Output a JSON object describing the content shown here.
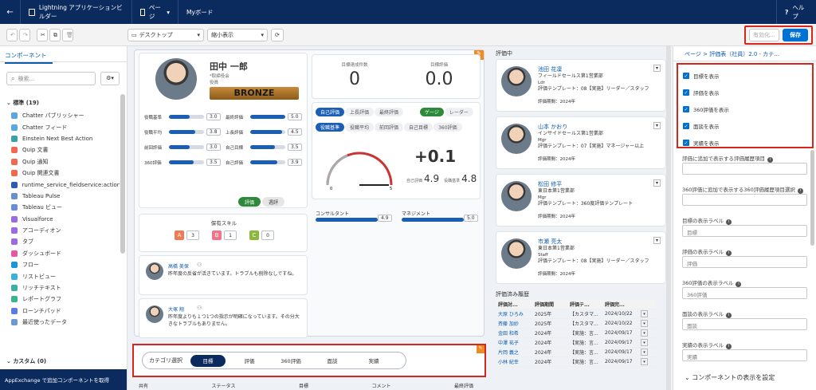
{
  "topbar": {
    "back_icon": "arrow-left-icon",
    "app_title": "Lightning アプリケーションビルダー",
    "page_menu": "ページ",
    "page_name": "Myボード",
    "help": "ヘルプ"
  },
  "toolbar": {
    "device": "デスクトップ",
    "view": "縮小表示",
    "save_secondary": "有効化...",
    "save": "保存"
  },
  "left": {
    "tab": "コンポーネント",
    "search_placeholder": "検索...",
    "standard_header": "標準 (19)",
    "items": [
      {
        "label": "Chatter パブリッシャー",
        "color": "#5aa7e0"
      },
      {
        "label": "Chatter フィード",
        "color": "#5aa7e0"
      },
      {
        "label": "Einstein Next Best Action",
        "color": "#3ba0a8"
      },
      {
        "label": "Quip 文書",
        "color": "#f26a4e"
      },
      {
        "label": "Quip 通知",
        "color": "#f26a4e"
      },
      {
        "label": "Quip 関連文書",
        "color": "#f26a4e"
      },
      {
        "label": "runtime_service_fieldservice:action...",
        "color": "#2f5ca8"
      },
      {
        "label": "Tableau Pulse",
        "color": "#6a8fd0"
      },
      {
        "label": "Tableau ビュー",
        "color": "#6a8fd0"
      },
      {
        "label": "Visualforce",
        "color": "#9d6be0"
      },
      {
        "label": "アコーディオン",
        "color": "#9d6be0"
      },
      {
        "label": "タブ",
        "color": "#9d6be0"
      },
      {
        "label": "ダッシュボード",
        "color": "#e25ba0"
      },
      {
        "label": "フロー",
        "color": "#1b96d2"
      },
      {
        "label": "リストビュー",
        "color": "#3bb0e0"
      },
      {
        "label": "リッチテキスト",
        "color": "#3bb0a0"
      },
      {
        "label": "レポートグラフ",
        "color": "#39b58a"
      },
      {
        "label": "ローンチパッド",
        "color": "#5b7be0"
      },
      {
        "label": "最近使ったデータ",
        "color": "#6d98d8"
      }
    ],
    "custom_header": "カスタム (0)",
    "appexchange": "AppExchange で追加コンポーネントを取得"
  },
  "profile": {
    "name": "田中 一郎",
    "sub1": "*取締役会",
    "sub2": "役員",
    "rank": "BRONZE",
    "left_metrics": [
      {
        "label": "役職基準",
        "value": "3.0",
        "fill": 0.6
      },
      {
        "label": "役職平均",
        "value": "3.8",
        "fill": 0.76
      },
      {
        "label": "前回評価",
        "value": "3.0",
        "fill": 0.6
      },
      {
        "label": "360評価",
        "value": "3.5",
        "fill": 0.7
      }
    ],
    "right_metrics": [
      {
        "label": "最終評価",
        "value": "5.0",
        "fill": 1.0
      },
      {
        "label": "上長評価",
        "value": "4.5",
        "fill": 0.9
      },
      {
        "label": "自己目標",
        "value": "3.5",
        "fill": 0.7
      },
      {
        "label": "自己評価",
        "value": "3.9",
        "fill": 0.78
      }
    ],
    "toggle_on": "評価",
    "toggle_off": "週評",
    "skills_title": "保有スキル",
    "skills": [
      {
        "letter": "A",
        "count": "3",
        "color": "#f07b53"
      },
      {
        "letter": "B",
        "count": "1",
        "color": "#f0758a"
      },
      {
        "letter": "C",
        "count": "0",
        "color": "#8ab93b"
      }
    ]
  },
  "comments": [
    {
      "name": "高橋 美保",
      "text": "昨年度の反省が活きています。トラブルも削除なしですね。"
    },
    {
      "name": "大塚 翔",
      "text": "昨年度よりも１つ1つの指示が明確になっています。その分大きなトラブルもありません。"
    }
  ],
  "score": {
    "label1": "目標達成件数",
    "value1": "0",
    "label2": "目標評価",
    "value2": "0.0",
    "tabs1": [
      "自己評価",
      "上長評価",
      "最終評価"
    ],
    "tabs1b": [
      "ゲージ",
      "レーダー"
    ],
    "tabs2": [
      "役職基準",
      "役職平均",
      "前回評価",
      "自己目標",
      "360評価"
    ],
    "delta": "+0.1",
    "gauge_min": "0",
    "gauge_max": "5",
    "self_label": "自己評価",
    "self_value": "4.9",
    "base_label": "役職基準",
    "base_value": "4.8",
    "consult_label": "コンサルタント",
    "consult_value": "4.9",
    "manage_label": "マネジメント",
    "manage_value": "5.0"
  },
  "category": {
    "label": "カテゴリ選択",
    "tabs": [
      "目標",
      "評価",
      "360評価",
      "面談",
      "実績"
    ],
    "table_headers": [
      "共有",
      "ステータス",
      "目標",
      "コメント",
      "最終評価"
    ]
  },
  "evaluating": {
    "title": "評価中",
    "people": [
      {
        "name": "池田 花凜",
        "dept": "フィールドセールス第1営業部",
        "role": "Ldr",
        "template": "評価テンプレート：08【実施】リーダー／スタッフ",
        "period": "評価期間：2024年"
      },
      {
        "name": "山本 かおり",
        "dept": "インサイドセールス第1営業部",
        "role": "Mgr",
        "template": "評価テンプレート：07【実施】マネージャー以上",
        "period": "評価期間：2024年"
      },
      {
        "name": "松田 修平",
        "dept": "東日本第1営業部",
        "role": "Mgr",
        "template": "評価テンプレート：360度評価テンプレート",
        "period": "評価期間：2024年"
      },
      {
        "name": "市瀬 亮太",
        "dept": "東日本第1営業部",
        "role": "Staff",
        "template": "評価テンプレート：08【実施】リーダー／スタッフ",
        "period": "評価期間：2024年"
      }
    ],
    "history_title": "評価済み履歴",
    "history_headers": [
      "評価対...",
      "評価期間",
      "評価テ...",
      "評価完..."
    ],
    "history_rows": [
      [
        "大原 ひろみ",
        "2025年",
        "【カスタマ...",
        "2024/10/22"
      ],
      [
        "斉藤 加妙",
        "2025年",
        "【カスタマ...",
        "2024/10/22"
      ],
      [
        "金田 和希",
        "2024年",
        "【実施：言...",
        "2024/09/17"
      ],
      [
        "中澤 祐子",
        "2024年",
        "【実施：言...",
        "2024/09/17"
      ],
      [
        "片岡 義之",
        "2024年",
        "【実施：言...",
        "2024/09/17"
      ],
      [
        "小林 紀幸",
        "2024年",
        "【実施：言...",
        "2024/09/17"
      ]
    ]
  },
  "right": {
    "breadcrumb_root": "ページ",
    "breadcrumb_current": "評価表（社員）2.0 - カテ...",
    "checkboxes": [
      "目標を表示",
      "評価を表示",
      "360評価を表示",
      "面談を表示",
      "実績を表示"
    ],
    "fields": [
      {
        "label": "評価に追加で表示する評価履歴項目",
        "value": ""
      },
      {
        "label": "360評価に追加で表示する360評価履歴項目選択",
        "value": ""
      },
      {
        "label": "目標の表示ラベル",
        "value": "目標"
      },
      {
        "label": "評価の表示ラベル",
        "value": "評価"
      },
      {
        "label": "360評価の表示ラベル",
        "value": "360評価"
      },
      {
        "label": "面談の表示ラベル",
        "value": "面談"
      },
      {
        "label": "実績の表示ラベル",
        "value": "実績"
      }
    ],
    "component_visibility": "コンポーネントの表示を設定"
  }
}
